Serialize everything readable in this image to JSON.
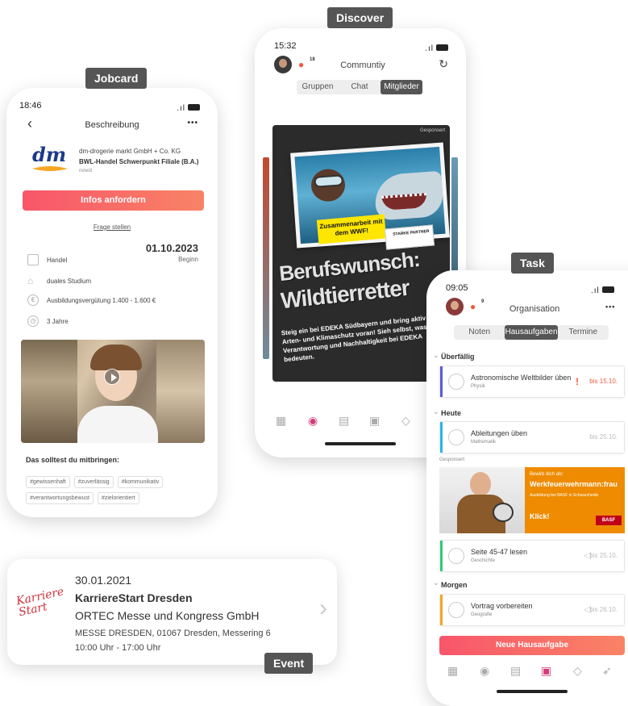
{
  "labels": {
    "jobcard": "Jobcard",
    "discover": "Discover",
    "task": "Task",
    "event": "Event"
  },
  "jobcard": {
    "time": "18:46",
    "header": "Beschreibung",
    "more": "•••",
    "company": "dm-drogerie markt GmbH + Co. KG",
    "position": "BWL-Handel Schwerpunkt Filiale (B.A.)",
    "gender": "m/w/d",
    "logo_text": "dm",
    "cta": "Infos anfordern",
    "ask": "Frage stellen",
    "date": "01.10.2023",
    "date_label": "Beginn",
    "details": [
      "Handel",
      "duales Studium",
      "Ausbildungsvergütung 1.400 - 1.600 €",
      "3 Jahre"
    ],
    "bring_title": "Das solltest du mitbringen:",
    "hashtags": [
      "#gewissenhaft",
      "#zuverlässig",
      "#kommunikativ",
      "#verantwortungsbewust",
      "#zielorientiert"
    ]
  },
  "discover": {
    "time": "15:32",
    "title": "Communtiy",
    "badge": "18",
    "tabs": [
      "Gruppen",
      "Chat",
      "Mitglieder"
    ],
    "sponsored": "Gesponsert",
    "sticker": "Zusammenarbeit mit dem WWF!",
    "partner": "STARKE PARTNER",
    "headline1": "Berufswunsch:",
    "headline2": "Wildtierretter",
    "body": "Steig ein bei EDEKA Südbayern und bring aktiv den Arten- und Klimaschutz voran! Sieh selbst, was Verantwortung und Nachhaltigkeit bei EDEKA bedeuten."
  },
  "task": {
    "time": "09:05",
    "title": "Organisation",
    "badge": "9",
    "more": "•••",
    "tabs": [
      "Noten",
      "Hausaufgaben",
      "Termine"
    ],
    "sections": {
      "overdue": "Überfällig",
      "today": "Heute",
      "tomorrow": "Morgen"
    },
    "tasks": [
      {
        "title": "Astronomische Weltbilder üben",
        "subject": "Physik",
        "due": "bis 15.10.",
        "color": "#5b5bd6"
      },
      {
        "title": "Ableitungen üben",
        "subject": "Mathematik",
        "due": "bis 25.10.",
        "color": "#29b6e8"
      },
      {
        "title": "Seite 45-47 lesen",
        "subject": "Geschichte",
        "due": "bis 25.10.",
        "color": "#2ecc71"
      },
      {
        "title": "Vortrag vorbereiten",
        "subject": "Geografie",
        "due": "bis 26.10.",
        "color": "#f5a623"
      }
    ],
    "sponsored": "Gesponsert",
    "ad": {
      "pre": "Bewirb dich als:",
      "title": "Werkfeuerwehrmann:frau",
      "sub": "Ausbildung bei BASF in Schwarzheide",
      "cta": "Klick!",
      "brand": "BASF"
    },
    "new_button": "Neue Hausaufgabe"
  },
  "event": {
    "date": "30.01.2021",
    "name": "KarriereStart Dresden",
    "organizer": "ORTEC Messe und Kongress GmbH",
    "address": "MESSE DRESDEN, 01067 Dresden, Messering 6",
    "hours": "10:00 Uhr - 17:00 Uhr",
    "logo": "Karriere Start"
  }
}
